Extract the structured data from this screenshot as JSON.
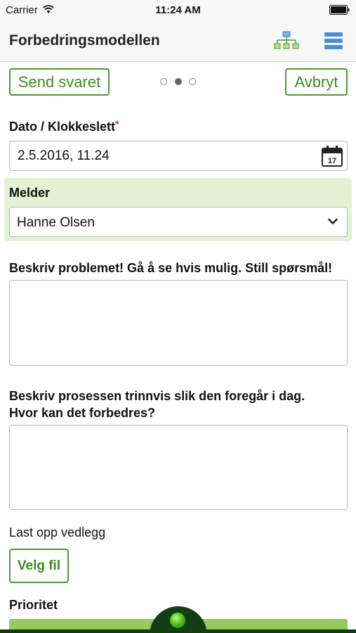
{
  "status_bar": {
    "carrier": "Carrier",
    "time": "11:24 AM"
  },
  "nav": {
    "title": "Forbedringsmodellen",
    "icons": [
      "org-chart-icon",
      "list-menu-icon"
    ]
  },
  "toolbar": {
    "send_label": "Send svaret",
    "cancel_label": "Avbryt",
    "page_indicator": {
      "total": 3,
      "current": 2
    }
  },
  "form": {
    "date": {
      "label": "Dato / Klokkeslett",
      "required_mark": "*",
      "value": "2.5.2016, 11.24",
      "calendar_day": "17"
    },
    "reporter": {
      "label": "Melder",
      "value": "Hanne Olsen"
    },
    "problem": {
      "label": "Beskriv problemet! Gå å se hvis mulig. Still spørsmål!",
      "value": ""
    },
    "process": {
      "label_line1": "Beskriv prosessen trinnvis slik den foregår i dag.",
      "label_line2": "Hvor kan det forbedres?",
      "value": ""
    },
    "attachment": {
      "label": "Last opp vedlegg",
      "button_label": "Velg fil"
    },
    "priority": {
      "label": "Prioritet"
    }
  },
  "colors": {
    "accent": "#4a9a32",
    "highlight_bg": "#e5f1d4",
    "required": "#c0392b",
    "bottom_bar": "#133d12"
  }
}
